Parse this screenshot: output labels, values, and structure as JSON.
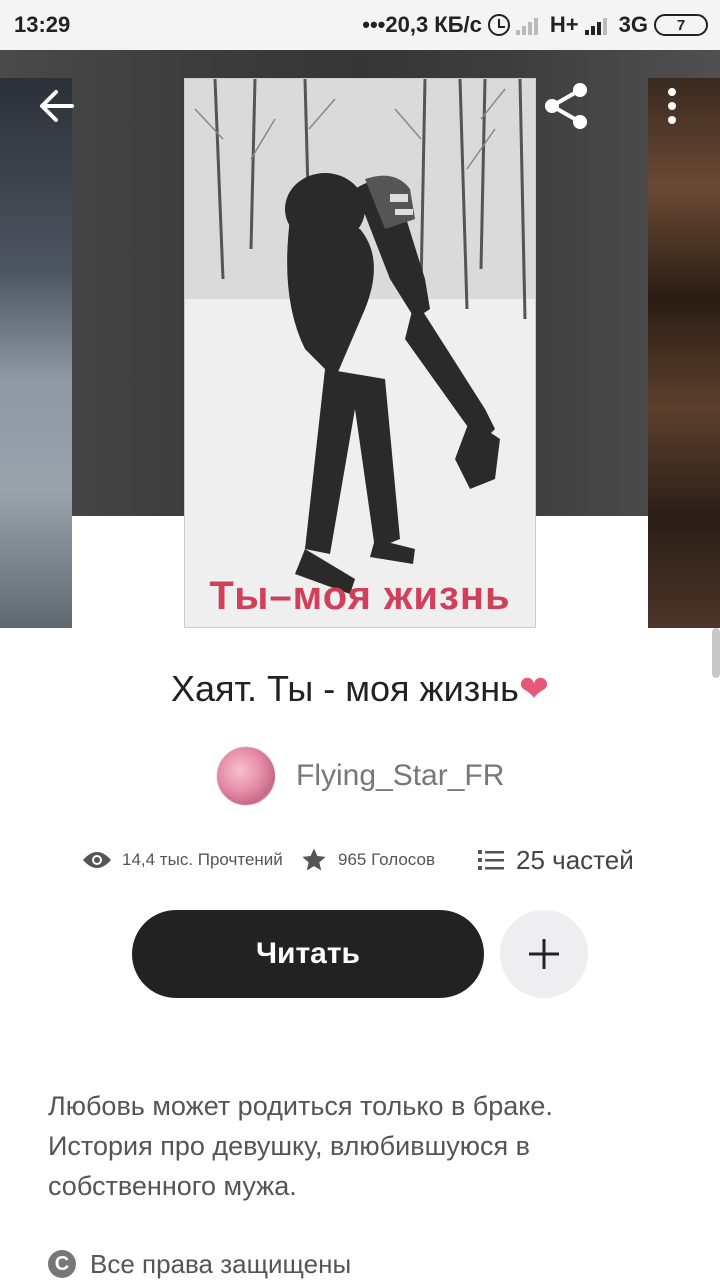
{
  "status_bar": {
    "time": "13:29",
    "network_speed": "•••20,3 КБ/с",
    "network_1": "H+",
    "network_2": "3G",
    "battery": "7"
  },
  "cover": {
    "title_overlay": "Ты–моя жизнь"
  },
  "story": {
    "title": "Хаят. Ты - моя жизнь",
    "title_emoji": "❤",
    "author": "Flying_Star_FR",
    "reads": "14,4 тыс. Прочтений",
    "votes": "965 Голосов",
    "parts": "25 частей",
    "read_button": "Читать",
    "description": "Любовь может родиться только в браке.\nИстория про девушку, влюбившуюся в собственного мужа.",
    "copyright_symbol": "C",
    "copyright": "Все права защищены"
  },
  "icons": {
    "back": "arrow-left-icon",
    "share": "share-icon",
    "more": "more-vert-icon",
    "reads": "eye-icon",
    "votes": "star-icon",
    "parts": "list-icon",
    "add": "plus-icon"
  },
  "colors": {
    "primary_button": "#222222",
    "heart": "#e5587a",
    "cover_title": "#d0405a"
  }
}
